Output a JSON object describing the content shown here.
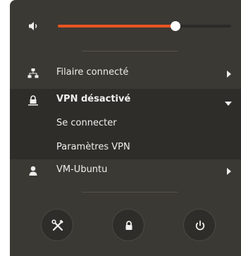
{
  "volume": {
    "level_percent": 68,
    "icon": "speaker-low-icon",
    "accent": "#e95420"
  },
  "menu": [
    {
      "label": "Filaire connecté",
      "icon": "wired-network-icon",
      "state": "collapsed"
    },
    {
      "label": "VPN désactivé",
      "icon": "vpn-lock-icon",
      "state": "expanded",
      "submenu": [
        {
          "label": "Se connecter"
        },
        {
          "label": "Paramètres VPN"
        }
      ]
    },
    {
      "label": "VM-Ubuntu",
      "icon": "user-icon",
      "state": "collapsed"
    }
  ],
  "actions": [
    {
      "icon": "settings-tools-icon"
    },
    {
      "icon": "lock-icon"
    },
    {
      "icon": "power-icon"
    }
  ],
  "colors": {
    "panel_bg": "#3b3934",
    "submenu_bg": "#2e2d29",
    "text": "#eeeeec"
  }
}
